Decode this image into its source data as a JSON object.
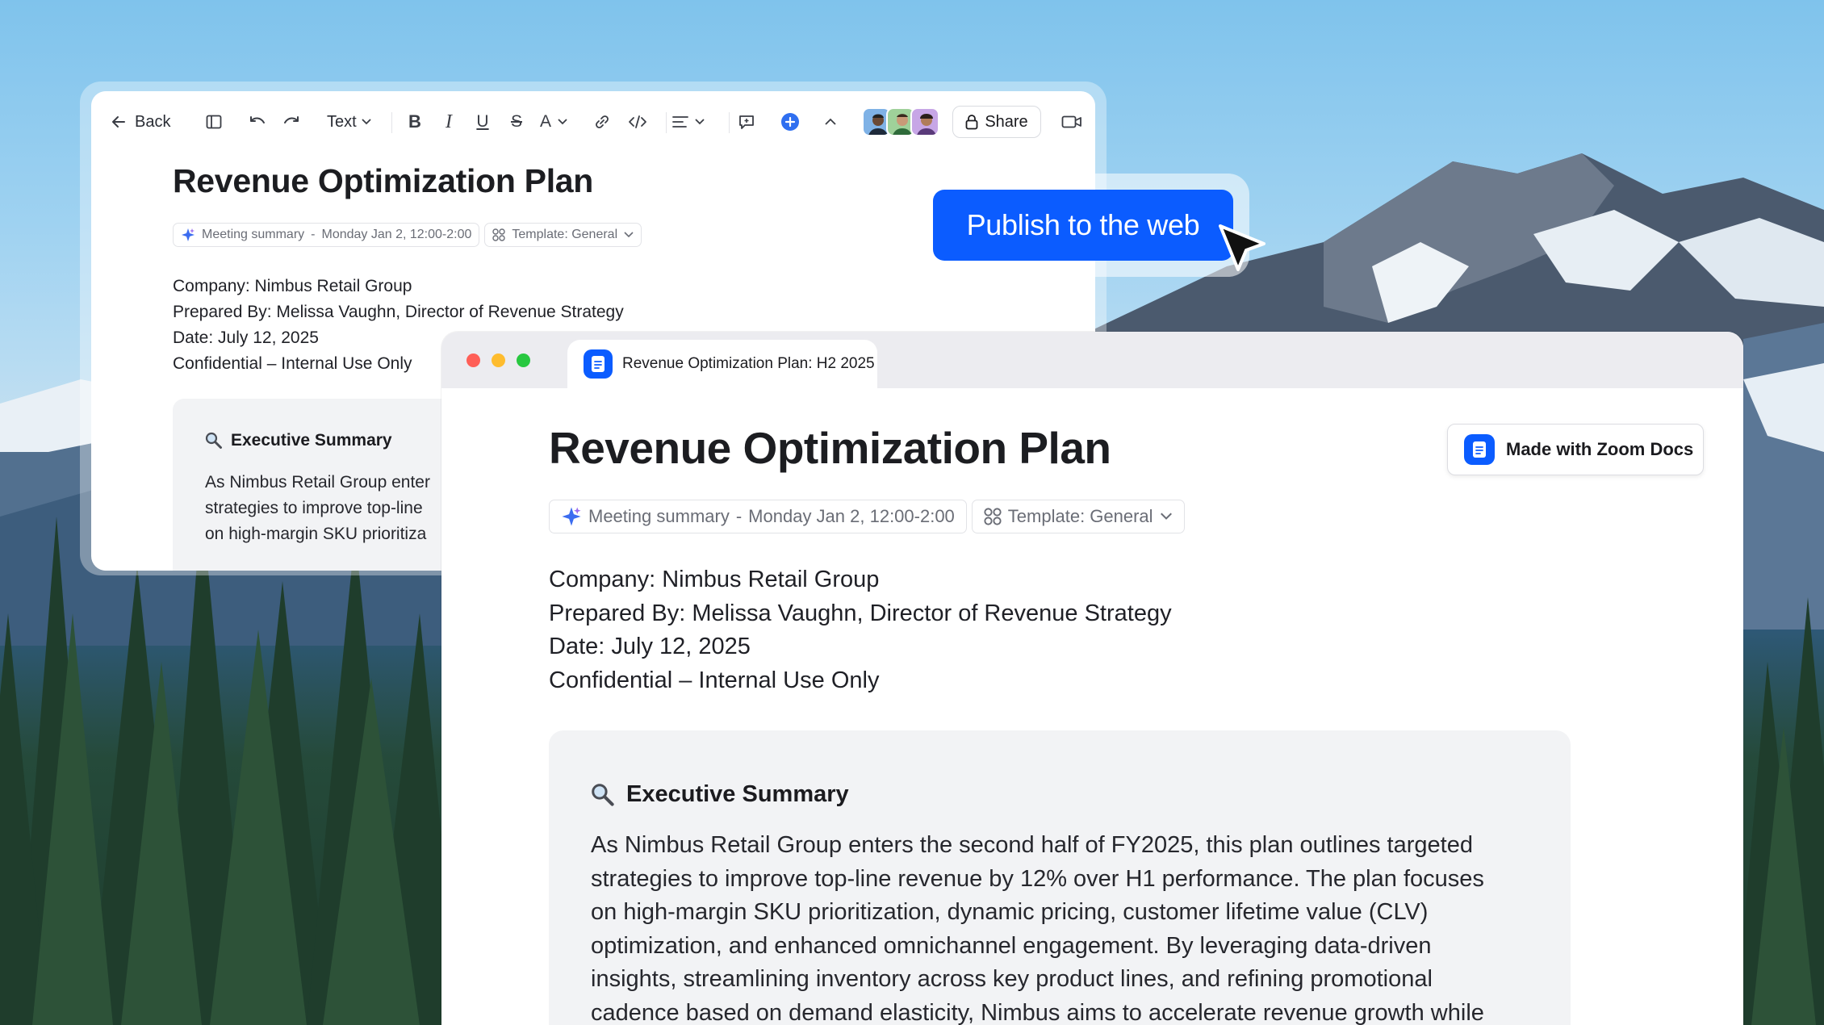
{
  "colors": {
    "accent": "#0b5cff",
    "traffic_red": "#ff5f57",
    "traffic_yellow": "#febc2e",
    "traffic_green": "#28c840"
  },
  "editor": {
    "toolbar": {
      "back_label": "Back",
      "text_style": "Text",
      "share_label": "Share",
      "icons": [
        "arrow-left-icon",
        "sidebar-icon",
        "undo-icon",
        "redo-icon",
        "bold-icon",
        "italic-icon",
        "underline-icon",
        "strikethrough-icon",
        "text-color-icon",
        "link-icon",
        "code-icon",
        "align-icon",
        "comment-icon",
        "add-icon",
        "collapse-icon",
        "lock-icon",
        "video-icon"
      ]
    },
    "title": "Revenue Optimization Plan",
    "chips": {
      "meeting": "Meeting summary",
      "separator": "-",
      "date": "Monday Jan 2, 12:00-2:00",
      "template": "Template: General"
    },
    "lines": {
      "company": "Company: Nimbus Retail Group",
      "prepared": "Prepared By: Melissa Vaughn, Director of Revenue Strategy",
      "date": "Date: July 12, 2025",
      "confidential": "Confidential – Internal Use Only"
    },
    "summary": {
      "title": "Executive Summary",
      "line1": "As Nimbus Retail Group enter",
      "line2": "strategies to improve top-line",
      "line3": "on high-margin SKU prioritiza"
    }
  },
  "publish": {
    "label": "Publish to the web"
  },
  "browser": {
    "tab_title": "Revenue Optimization Plan: H2 2025",
    "badge": "Made with Zoom Docs",
    "title": "Revenue Optimization Plan",
    "chips": {
      "meeting": "Meeting summary",
      "separator": "-",
      "date": "Monday Jan 2, 12:00-2:00",
      "template": "Template: General"
    },
    "lines": {
      "company": "Company: Nimbus Retail Group",
      "prepared": "Prepared By: Melissa Vaughn, Director of Revenue Strategy",
      "date": "Date: July 12, 2025",
      "confidential": "Confidential – Internal Use Only"
    },
    "summary": {
      "title": "Executive Summary",
      "line1": "As Nimbus Retail Group enters the second half of FY2025, this plan outlines targeted",
      "line2": "strategies to improve top-line revenue by 12% over H1 performance. The plan focuses",
      "line3": "on high-margin SKU prioritization, dynamic pricing, customer lifetime value (CLV)",
      "line4": "optimization, and enhanced omnichannel engagement. By leveraging data-driven",
      "line5": "insights, streamlining inventory across key product lines, and refining promotional",
      "line6": "cadence based on demand elasticity, Nimbus aims to accelerate revenue growth while"
    }
  }
}
